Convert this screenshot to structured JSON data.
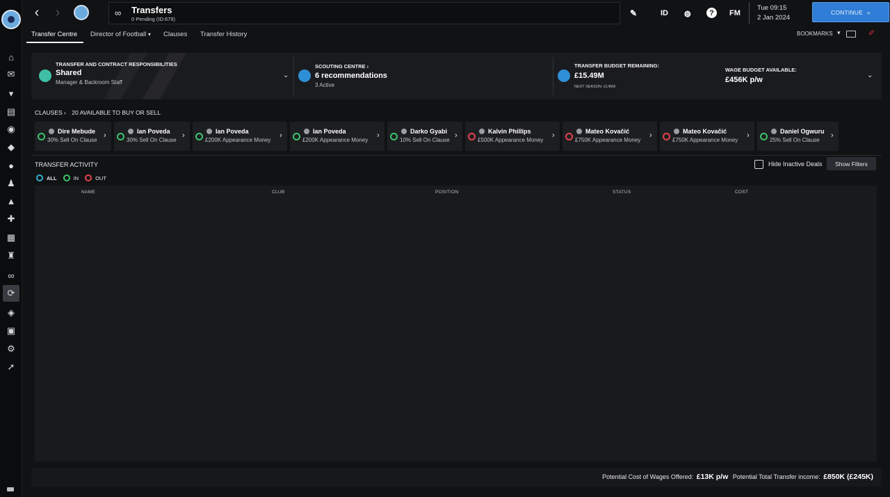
{
  "header": {
    "title": "Transfers",
    "subtitle": "0 Pending (ID:679)",
    "id_label": "ID",
    "fm_label": "FM",
    "help_label": "?",
    "time": "Tue 09:15",
    "date": "2 Jan 2024",
    "continue_label": "CONTINUE"
  },
  "tabs": [
    {
      "label": "Transfer Centre"
    },
    {
      "label": "Director of Football"
    },
    {
      "label": "Clauses"
    },
    {
      "label": "Transfer History"
    }
  ],
  "bookmarks_label": "BOOKMARKS",
  "info": {
    "responsibilities": {
      "label": "TRANSFER AND CONTRACT RESPONSIBILITIES",
      "value": "Shared",
      "detail": "Manager & Backroom Staff"
    },
    "scouting": {
      "label": "SCOUTING CENTRE",
      "value": "6 recommendations",
      "detail": "3 Active"
    },
    "budget": {
      "label": "TRANSFER BUDGET REMAINING:",
      "value": "£15.49M",
      "detail": "NEXT SEASON: £145M"
    },
    "wage": {
      "label": "WAGE BUDGET AVAILABLE:",
      "value": "£456K p/w"
    }
  },
  "clauses": {
    "label": "CLAUSES",
    "count": "20 AVAILABLE TO BUY OR SELL",
    "items": [
      {
        "name": "Dire Mebude",
        "detail": "30% Sell On Clause",
        "direction": "in"
      },
      {
        "name": "Ian Poveda",
        "detail": "30% Sell On Clause",
        "direction": "in"
      },
      {
        "name": "Ian Poveda",
        "detail": "£200K Appearance Money",
        "direction": "in"
      },
      {
        "name": "Ian Poveda",
        "detail": "£200K Appearance Money",
        "direction": "in"
      },
      {
        "name": "Darko Gyabi",
        "detail": "10% Sell On Clause",
        "direction": "in"
      },
      {
        "name": "Kalvin Phillips",
        "detail": "£500K Appearance Money",
        "direction": "out"
      },
      {
        "name": "Mateo Kovačić",
        "detail": "£750K Appearance Money",
        "direction": "out"
      },
      {
        "name": "Mateo Kovačić",
        "detail": "£750K Appearance Money",
        "direction": "out"
      },
      {
        "name": "Daniel Ogwuru",
        "detail": "25% Sell On Clause",
        "direction": "in"
      }
    ]
  },
  "activity": {
    "title": "TRANSFER ACTIVITY",
    "hide_inactive": "Hide Inactive Deals",
    "show_filters": "Show Filters",
    "filters": [
      "ALL",
      "IN",
      "OUT"
    ],
    "columns": [
      "NAME",
      "CLUB",
      "POSITION",
      "STATUS",
      "COST"
    ]
  },
  "footer": {
    "wages_label": "Potential Cost of Wages Offered:",
    "wages_value": "£13K p/w",
    "income_label": "Potential Total Transfer income:",
    "income_value": "£850K (£245K)"
  },
  "colors": {
    "accent": "#2f7dd6",
    "in": "#3cc46a",
    "out": "#e3434c",
    "all": "#2fb1c8",
    "club": "#6cabdd"
  }
}
